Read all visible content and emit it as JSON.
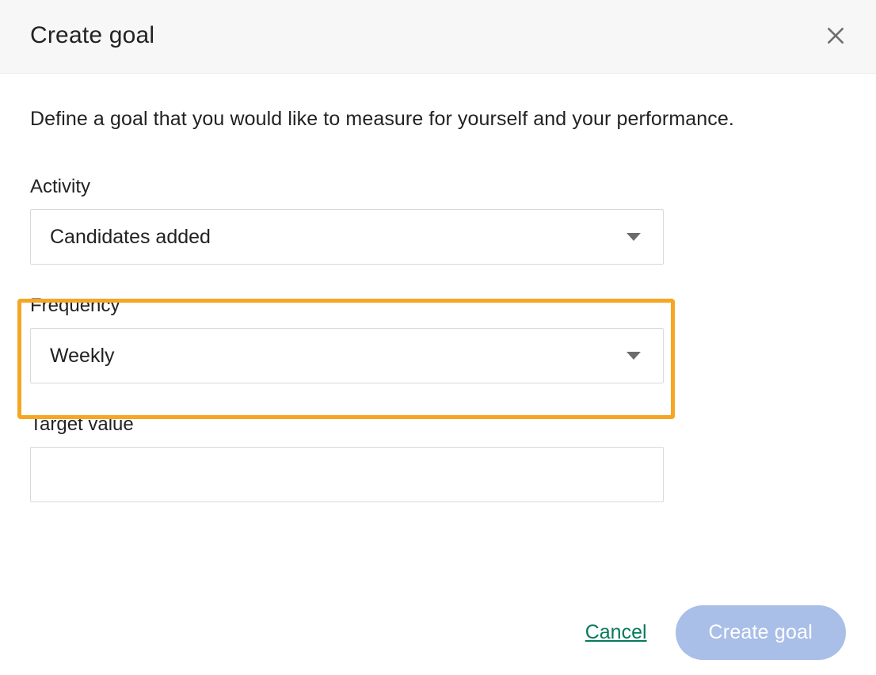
{
  "header": {
    "title": "Create goal"
  },
  "body": {
    "description": "Define a goal that you would like to measure for yourself and your performance."
  },
  "form": {
    "activity": {
      "label": "Activity",
      "value": "Candidates added"
    },
    "frequency": {
      "label": "Frequency",
      "value": "Weekly"
    },
    "target": {
      "label": "Target value",
      "value": ""
    }
  },
  "footer": {
    "cancel": "Cancel",
    "submit": "Create goal"
  },
  "colors": {
    "highlight": "#f5a623",
    "submit_bg": "#a9bfe8",
    "cancel_link": "#067a5b"
  }
}
